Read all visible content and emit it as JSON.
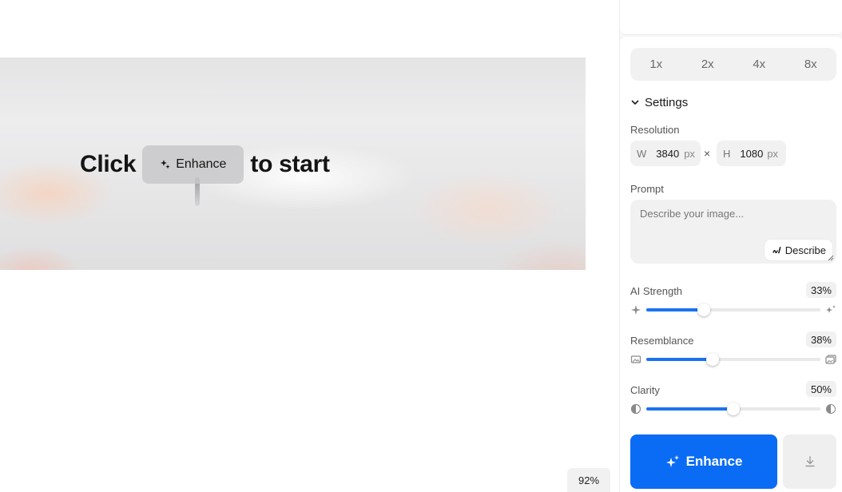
{
  "canvas": {
    "cta": {
      "before": "Click",
      "button_label": "Enhance",
      "after": "to start"
    },
    "zoom": "92%"
  },
  "panel": {
    "scales": [
      "1x",
      "2x",
      "4x",
      "8x"
    ],
    "settings": {
      "title": "Settings"
    },
    "resolution": {
      "label": "Resolution",
      "width": {
        "tag": "W",
        "value": "3840",
        "unit": "px"
      },
      "height": {
        "tag": "H",
        "value": "1080",
        "unit": "px"
      },
      "separator": "×"
    },
    "prompt": {
      "label": "Prompt",
      "placeholder": "Describe your image...",
      "describe_label": "Describe"
    },
    "sliders": {
      "ai_strength": {
        "label": "AI Strength",
        "display": "33%",
        "value": 0.33
      },
      "resemblance": {
        "label": "Resemblance",
        "display": "38%",
        "value": 0.38
      },
      "clarity": {
        "label": "Clarity",
        "display": "50%",
        "value": 0.5
      }
    },
    "enhance_label": "Enhance"
  },
  "colors": {
    "accent": "#0a6cf4",
    "slider_fill": "#1a73ef"
  },
  "icons": {
    "cta": "sparkle-icon",
    "settings": "chevron-down-icon",
    "describe": "pen-icon",
    "ai_l": "sparkle-icon",
    "ai_r": "sparkles-icon",
    "res_l": "image-icon",
    "res_r": "images-icon",
    "clar_l": "contrast-icon",
    "clar_r": "contrast-filled-icon",
    "enhance": "sparkles-icon",
    "download": "download-icon"
  }
}
